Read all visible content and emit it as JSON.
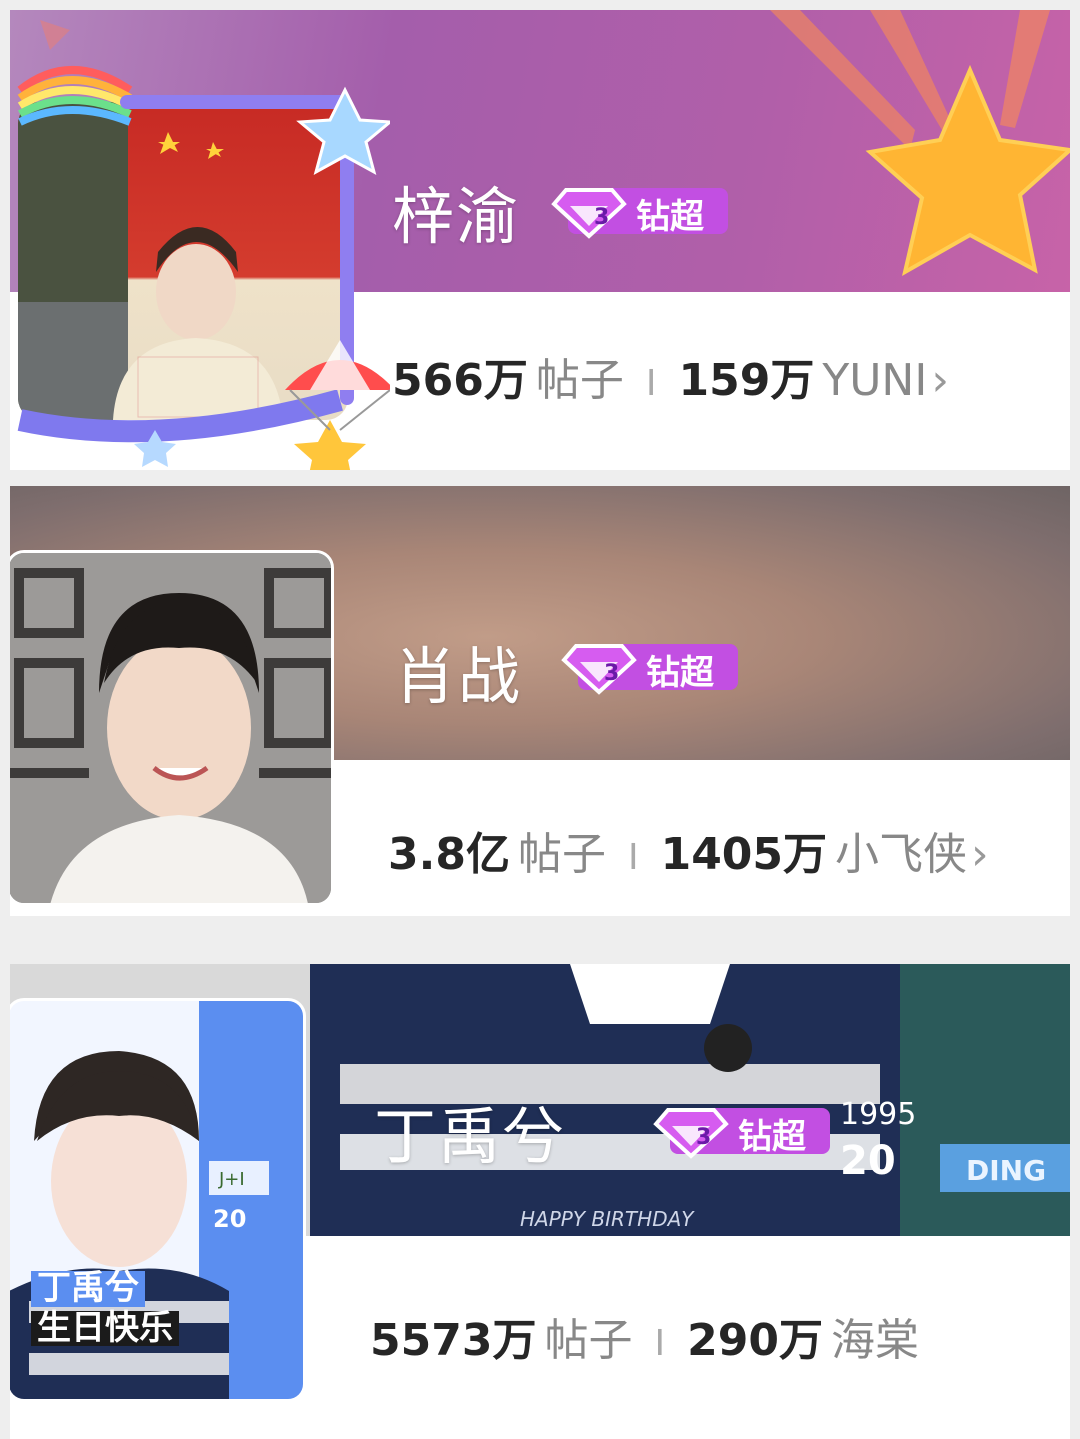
{
  "cards": [
    {
      "name": "梓渝",
      "badge": "钻超",
      "posts_value": "566万",
      "posts_label": "帖子",
      "separator": "I",
      "fans_value": "159万",
      "fans_label": "YUNI",
      "chevron": "›",
      "banner_colors": [
        "#b27ab0",
        "#a55dae",
        "#c05fa8"
      ]
    },
    {
      "name": "肖战",
      "badge": "钻超",
      "posts_value": "3.8亿",
      "posts_label": "帖子",
      "separator": "I",
      "fans_value": "1405万",
      "fans_label": "小飞侠",
      "chevron": "›",
      "banner_colors": [
        "#7b6a68",
        "#b98f80",
        "#8a7670"
      ]
    },
    {
      "name": "丁禹兮",
      "badge": "钻超",
      "posts_value": "5573万",
      "posts_label": "帖子",
      "separator": "I",
      "fans_value": "290万",
      "fans_label": "海棠",
      "avatar_text_line1": "丁禹兮",
      "avatar_text_line2": "生日快乐",
      "avatar_date": "20",
      "banner_text_1": "1995",
      "banner_text_2": "20",
      "banner_text_3": "HAPPY BIRTHDAY",
      "banner_tag": "DING"
    }
  ],
  "theme": {
    "badge_color": "#c04fe0",
    "badge_color_2": "#9a3fd6",
    "text_dark": "#262626",
    "text_gray": "#888888"
  },
  "icons": {
    "badge_icon": "diamond-level-3-icon",
    "chevron": "chevron-right-icon"
  }
}
